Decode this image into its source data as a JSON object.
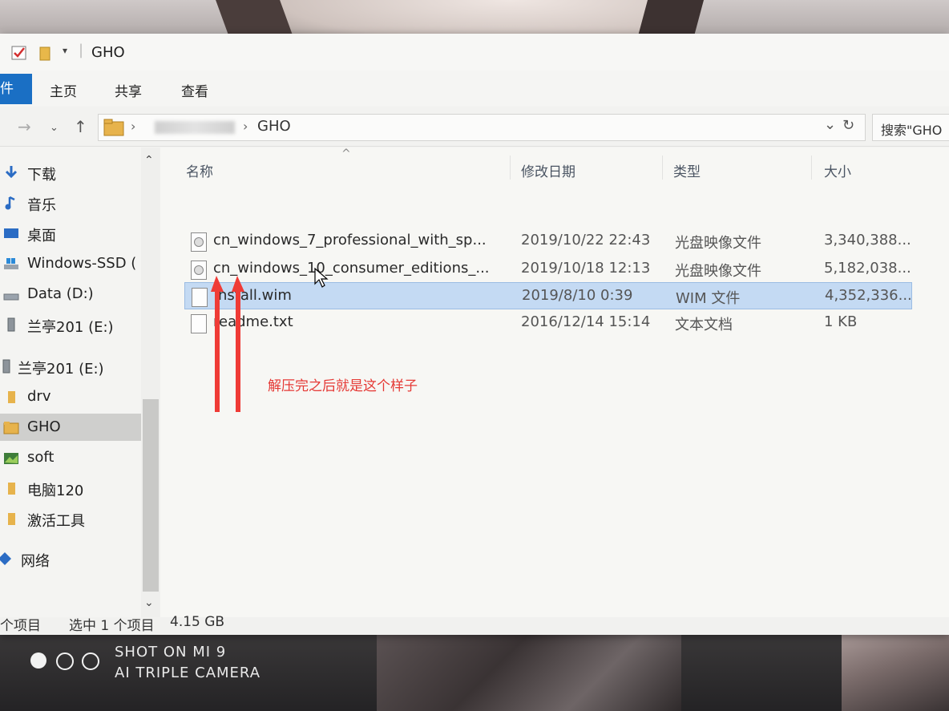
{
  "window": {
    "title": "GHO"
  },
  "ribbon": {
    "file_tab": "件",
    "tabs": [
      "主页",
      "共享",
      "查看"
    ]
  },
  "address": {
    "folder": "GHO",
    "search_placeholder": "搜索\"GHO"
  },
  "sidebar": {
    "items": [
      {
        "label": "下载",
        "icon": "download-arrow-icon"
      },
      {
        "label": "音乐",
        "icon": "music-note-icon"
      },
      {
        "label": "桌面",
        "icon": "desktop-icon"
      },
      {
        "label": "Windows-SSD (",
        "icon": "windows-drive-icon"
      },
      {
        "label": "Data (D:)",
        "icon": "drive-icon"
      },
      {
        "label": "兰亭201 (E:)",
        "icon": "usb-drive-icon"
      },
      {
        "label": "兰亭201 (E:)",
        "icon": "usb-drive-icon"
      },
      {
        "label": "drv",
        "icon": "folder-icon"
      },
      {
        "label": "GHO",
        "icon": "folder-icon"
      },
      {
        "label": "soft",
        "icon": "image-folder-icon"
      },
      {
        "label": "电脑120",
        "icon": "folder-icon"
      },
      {
        "label": "激活工具",
        "icon": "folder-icon"
      },
      {
        "label": "网络",
        "icon": "network-icon"
      }
    ]
  },
  "columns": {
    "name": "名称",
    "date": "修改日期",
    "type": "类型",
    "size": "大小"
  },
  "files": [
    {
      "name": "cn_windows_7_professional_with_sp...",
      "date": "2019/10/22 22:43",
      "type": "光盘映像文件",
      "size": "3,340,388..."
    },
    {
      "name": "cn_windows_10_consumer_editions_...",
      "date": "2019/10/18 12:13",
      "type": "光盘映像文件",
      "size": "5,182,038..."
    },
    {
      "name": "install.wim",
      "date": "2019/8/10 0:39",
      "type": "WIM 文件",
      "size": "4,352,336..."
    },
    {
      "name": "readme.txt",
      "date": "2016/12/14 15:14",
      "type": "文本文档",
      "size": "1 KB"
    }
  ],
  "status": {
    "items": "个项目",
    "selected": "选中 1 个项目",
    "selected_size": "4.15 GB"
  },
  "annotation": {
    "text": "解压完之后就是这个样子",
    "color": "#e53935"
  },
  "watermark": {
    "line1": "SHOT ON MI 9",
    "line2": "AI TRIPLE CAMERA"
  },
  "colors": {
    "selection": "#c4daf3",
    "file_tab": "#1a6fc4"
  }
}
